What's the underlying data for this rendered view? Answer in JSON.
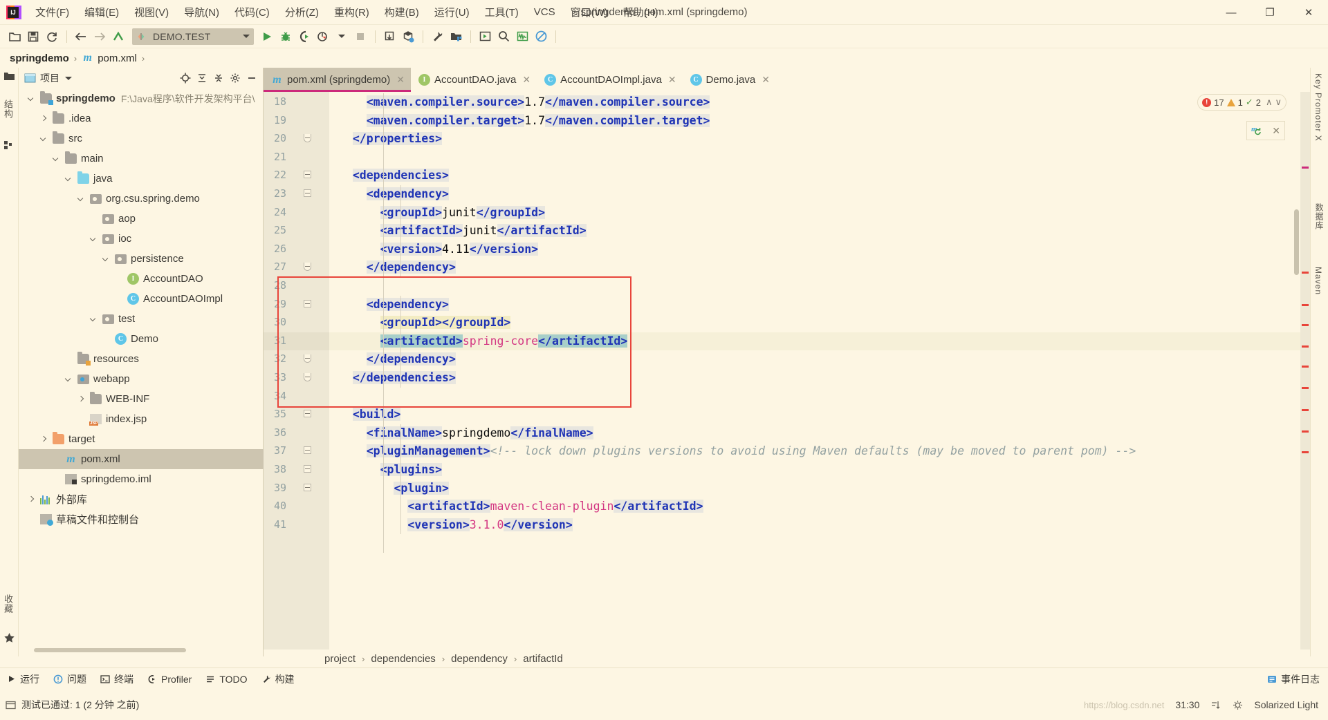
{
  "window": {
    "title": "springdemo - pom.xml (springdemo)",
    "minimize": "—",
    "maximize": "❐",
    "close": "✕"
  },
  "menu": [
    {
      "label": "文件(F)"
    },
    {
      "label": "编辑(E)"
    },
    {
      "label": "视图(V)"
    },
    {
      "label": "导航(N)"
    },
    {
      "label": "代码(C)"
    },
    {
      "label": "分析(Z)"
    },
    {
      "label": "重构(R)"
    },
    {
      "label": "构建(B)"
    },
    {
      "label": "运行(U)"
    },
    {
      "label": "工具(T)"
    },
    {
      "label": "VCS"
    },
    {
      "label": "窗口(W)"
    },
    {
      "label": "帮助(H)"
    }
  ],
  "toolbar": {
    "run_config": "DEMO.TEST",
    "icons": [
      "open-project-icon",
      "save-all-icon",
      "sync-icon",
      "back-icon",
      "forward-icon",
      "jump-to-source-icon",
      "run-icon",
      "debug-icon",
      "run-coverage-icon",
      "profile-icon",
      "stop-icon",
      "update-project-icon",
      "commit-icon",
      "settings-icon",
      "project-structure-icon",
      "run-anything-icon",
      "search-everywhere-icon",
      "activity-monitor-icon",
      "no-access-icon"
    ]
  },
  "navbar": {
    "project": "springdemo",
    "file": "pom.xml",
    "separator": "›"
  },
  "project_panel": {
    "title": "项目",
    "tools": [
      "locate-icon",
      "expand-all-icon",
      "collapse-all-icon",
      "gear-icon",
      "hide-icon"
    ],
    "tree": [
      {
        "label": "springdemo",
        "path": "F:\\Java程序\\软件开发架构平台\\",
        "indent": 0,
        "arrow": "down",
        "icon": "module-folder",
        "bold": true
      },
      {
        "label": ".idea",
        "indent": 1,
        "arrow": "right",
        "icon": "folder"
      },
      {
        "label": "src",
        "indent": 1,
        "arrow": "down",
        "icon": "folder"
      },
      {
        "label": "main",
        "indent": 2,
        "arrow": "down",
        "icon": "folder"
      },
      {
        "label": "java",
        "indent": 3,
        "arrow": "down",
        "icon": "source-folder"
      },
      {
        "label": "org.csu.spring.demo",
        "indent": 4,
        "arrow": "down",
        "icon": "package"
      },
      {
        "label": "aop",
        "indent": 5,
        "arrow": "none",
        "icon": "package"
      },
      {
        "label": "ioc",
        "indent": 5,
        "arrow": "down",
        "icon": "package"
      },
      {
        "label": "persistence",
        "indent": 6,
        "arrow": "down",
        "icon": "package"
      },
      {
        "label": "AccountDAO",
        "indent": 7,
        "arrow": "none",
        "icon": "interface"
      },
      {
        "label": "AccountDAOImpl",
        "indent": 7,
        "arrow": "none",
        "icon": "class"
      },
      {
        "label": "test",
        "indent": 5,
        "arrow": "down",
        "icon": "package"
      },
      {
        "label": "Demo",
        "indent": 6,
        "arrow": "none",
        "icon": "class-run"
      },
      {
        "label": "resources",
        "indent": 3,
        "arrow": "none",
        "icon": "resource-folder"
      },
      {
        "label": "webapp",
        "indent": 3,
        "arrow": "down",
        "icon": "web-folder"
      },
      {
        "label": "WEB-INF",
        "indent": 4,
        "arrow": "right",
        "icon": "folder"
      },
      {
        "label": "index.jsp",
        "indent": 4,
        "arrow": "none",
        "icon": "jsp"
      },
      {
        "label": "target",
        "indent": 1,
        "arrow": "right",
        "icon": "excluded-folder"
      },
      {
        "label": "pom.xml",
        "indent": 2,
        "arrow": "none",
        "icon": "maven",
        "selected": true
      },
      {
        "label": "springdemo.iml",
        "indent": 2,
        "arrow": "none",
        "icon": "iml"
      },
      {
        "label": "外部库",
        "indent": 0,
        "arrow": "right",
        "icon": "library"
      },
      {
        "label": "草稿文件和控制台",
        "indent": 0,
        "arrow": "none",
        "icon": "scratches"
      }
    ],
    "vertical_tabs": [
      "结构",
      "收藏"
    ]
  },
  "editor_tabs": [
    {
      "label": "pom.xml (springdemo)",
      "icon": "maven-icon",
      "active": true,
      "close": "✕"
    },
    {
      "label": "AccountDAO.java",
      "icon": "interface-icon",
      "active": false,
      "close": "✕"
    },
    {
      "label": "AccountDAOImpl.java",
      "icon": "class-icon",
      "active": false,
      "close": "✕"
    },
    {
      "label": "Demo.java",
      "icon": "class-run-icon",
      "active": false,
      "close": "✕"
    }
  ],
  "inspection": {
    "errors": "17",
    "warnings": "1",
    "checks": "2",
    "up": "∧",
    "down": "∨"
  },
  "code": {
    "first_line_number": 18,
    "caret_line_index": 13,
    "lines": [
      {
        "n": 18,
        "indent": 0,
        "fold": "none",
        "spans": [
          {
            "t": "    ",
            "c": ""
          },
          {
            "t": "<maven.compiler.source>",
            "c": "tag hl"
          },
          {
            "t": "1.7",
            "c": "val"
          },
          {
            "t": "</maven.compiler.source>",
            "c": "tag hl"
          }
        ]
      },
      {
        "n": 19,
        "indent": 0,
        "fold": "none",
        "spans": [
          {
            "t": "    ",
            "c": ""
          },
          {
            "t": "<maven.compiler.target>",
            "c": "tag hl"
          },
          {
            "t": "1.7",
            "c": "val"
          },
          {
            "t": "</maven.compiler.target>",
            "c": "tag hl"
          }
        ]
      },
      {
        "n": 20,
        "indent": 0,
        "fold": "end",
        "spans": [
          {
            "t": "  ",
            "c": ""
          },
          {
            "t": "</properties>",
            "c": "tag hl"
          }
        ]
      },
      {
        "n": 21,
        "indent": 0,
        "fold": "none",
        "spans": []
      },
      {
        "n": 22,
        "indent": 0,
        "fold": "start",
        "spans": [
          {
            "t": "  ",
            "c": ""
          },
          {
            "t": "<dependencies>",
            "c": "tag hl"
          }
        ]
      },
      {
        "n": 23,
        "indent": 0,
        "fold": "start",
        "spans": [
          {
            "t": "    ",
            "c": ""
          },
          {
            "t": "<dependency>",
            "c": "tag hl"
          }
        ]
      },
      {
        "n": 24,
        "indent": 1,
        "fold": "none",
        "spans": [
          {
            "t": "      ",
            "c": ""
          },
          {
            "t": "<groupId>",
            "c": "tag hl"
          },
          {
            "t": "junit",
            "c": "val"
          },
          {
            "t": "</groupId>",
            "c": "tag hl"
          }
        ]
      },
      {
        "n": 25,
        "indent": 1,
        "fold": "none",
        "spans": [
          {
            "t": "      ",
            "c": ""
          },
          {
            "t": "<artifactId>",
            "c": "tag hl"
          },
          {
            "t": "junit",
            "c": "val"
          },
          {
            "t": "</artifactId>",
            "c": "tag hl"
          }
        ]
      },
      {
        "n": 26,
        "indent": 1,
        "fold": "none",
        "spans": [
          {
            "t": "      ",
            "c": ""
          },
          {
            "t": "<version>",
            "c": "tag hl"
          },
          {
            "t": "4.11",
            "c": "val"
          },
          {
            "t": "</version>",
            "c": "tag hl"
          }
        ]
      },
      {
        "n": 27,
        "indent": 0,
        "fold": "end",
        "spans": [
          {
            "t": "    ",
            "c": ""
          },
          {
            "t": "</dependency>",
            "c": "tag hl"
          }
        ]
      },
      {
        "n": 28,
        "indent": 0,
        "fold": "none",
        "spans": []
      },
      {
        "n": 29,
        "indent": 0,
        "fold": "start",
        "spans": [
          {
            "t": "    ",
            "c": ""
          },
          {
            "t": "<dependency>",
            "c": "tag hl"
          }
        ]
      },
      {
        "n": 30,
        "indent": 1,
        "fold": "none",
        "spans": [
          {
            "t": "      ",
            "c": ""
          },
          {
            "t": "<groupId></groupId>",
            "c": "tag hl-y"
          }
        ]
      },
      {
        "n": 31,
        "indent": 1,
        "fold": "none",
        "caret": true,
        "spans": [
          {
            "t": "      ",
            "c": ""
          },
          {
            "t": "<artifactId>",
            "c": "tag hl-sel"
          },
          {
            "t": "spring-core",
            "c": "attrv"
          },
          {
            "t": "</artifactId>",
            "c": "tag hl-sel"
          }
        ]
      },
      {
        "n": 32,
        "indent": 0,
        "fold": "end",
        "spans": [
          {
            "t": "    ",
            "c": ""
          },
          {
            "t": "</dependency>",
            "c": "tag hl"
          }
        ]
      },
      {
        "n": 33,
        "indent": 0,
        "fold": "end",
        "spans": [
          {
            "t": "  ",
            "c": ""
          },
          {
            "t": "</dependencies>",
            "c": "tag hl"
          }
        ]
      },
      {
        "n": 34,
        "indent": 0,
        "fold": "none",
        "spans": []
      },
      {
        "n": 35,
        "indent": 0,
        "fold": "start",
        "spans": [
          {
            "t": "  ",
            "c": ""
          },
          {
            "t": "<build>",
            "c": "tag hl"
          }
        ]
      },
      {
        "n": 36,
        "indent": 0,
        "fold": "none",
        "spans": [
          {
            "t": "    ",
            "c": ""
          },
          {
            "t": "<finalName>",
            "c": "tag hl"
          },
          {
            "t": "springdemo",
            "c": "val"
          },
          {
            "t": "</finalName>",
            "c": "tag hl"
          }
        ]
      },
      {
        "n": 37,
        "indent": 0,
        "fold": "start",
        "spans": [
          {
            "t": "    ",
            "c": ""
          },
          {
            "t": "<pluginManagement>",
            "c": "tag hl"
          },
          {
            "t": "<!-- lock down plugins versions to avoid using Maven defaults (may be moved to parent pom) -->",
            "c": "cmt"
          }
        ]
      },
      {
        "n": 38,
        "indent": 1,
        "fold": "start",
        "spans": [
          {
            "t": "      ",
            "c": ""
          },
          {
            "t": "<plugins>",
            "c": "tag hl"
          }
        ]
      },
      {
        "n": 39,
        "indent": 1,
        "fold": "start",
        "spans": [
          {
            "t": "        ",
            "c": ""
          },
          {
            "t": "<plugin>",
            "c": "tag hl"
          }
        ]
      },
      {
        "n": 40,
        "indent": 2,
        "fold": "none",
        "spans": [
          {
            "t": "          ",
            "c": ""
          },
          {
            "t": "<artifactId>",
            "c": "tag hl"
          },
          {
            "t": "maven-clean-plugin",
            "c": "attrv"
          },
          {
            "t": "</artifactId>",
            "c": "tag hl"
          }
        ]
      },
      {
        "n": 41,
        "indent": 2,
        "fold": "none",
        "spans": [
          {
            "t": "          ",
            "c": ""
          },
          {
            "t": "<version>",
            "c": "tag hl"
          },
          {
            "t": "3.1.0",
            "c": "attrv"
          },
          {
            "t": "</version>",
            "c": "tag hl"
          }
        ]
      }
    ]
  },
  "editor_crumbs": [
    "project",
    "dependencies",
    "dependency",
    "artifactId"
  ],
  "bottom_bar": {
    "items": [
      {
        "label": "运行",
        "icon": "run-icon"
      },
      {
        "label": "问题",
        "icon": "problems-icon"
      },
      {
        "label": "终端",
        "icon": "terminal-icon"
      },
      {
        "label": "Profiler",
        "icon": "profiler-icon"
      },
      {
        "label": "TODO",
        "icon": "todo-icon"
      },
      {
        "label": "构建",
        "icon": "build-icon"
      }
    ],
    "event_log": "事件日志"
  },
  "statusbar": {
    "message": "测试已通过: 1 (2 分钟 之前)",
    "caret_position": "31:30",
    "theme": "Solarized Light",
    "ghost_url": "https://blog.csdn.net"
  },
  "right_strip": {
    "tabs": [
      "Key Promoter X",
      "数据库",
      "Maven"
    ]
  },
  "colors": {
    "background": "#fdf6e3",
    "gutter": "#eee8d5",
    "selection": "#cdc5b0",
    "tab_underline": "#cc2a7b",
    "highlight_box": "#e8443a",
    "tag": "#1f34b5",
    "attr_value": "#d33682",
    "comment": "#93a1a1"
  }
}
